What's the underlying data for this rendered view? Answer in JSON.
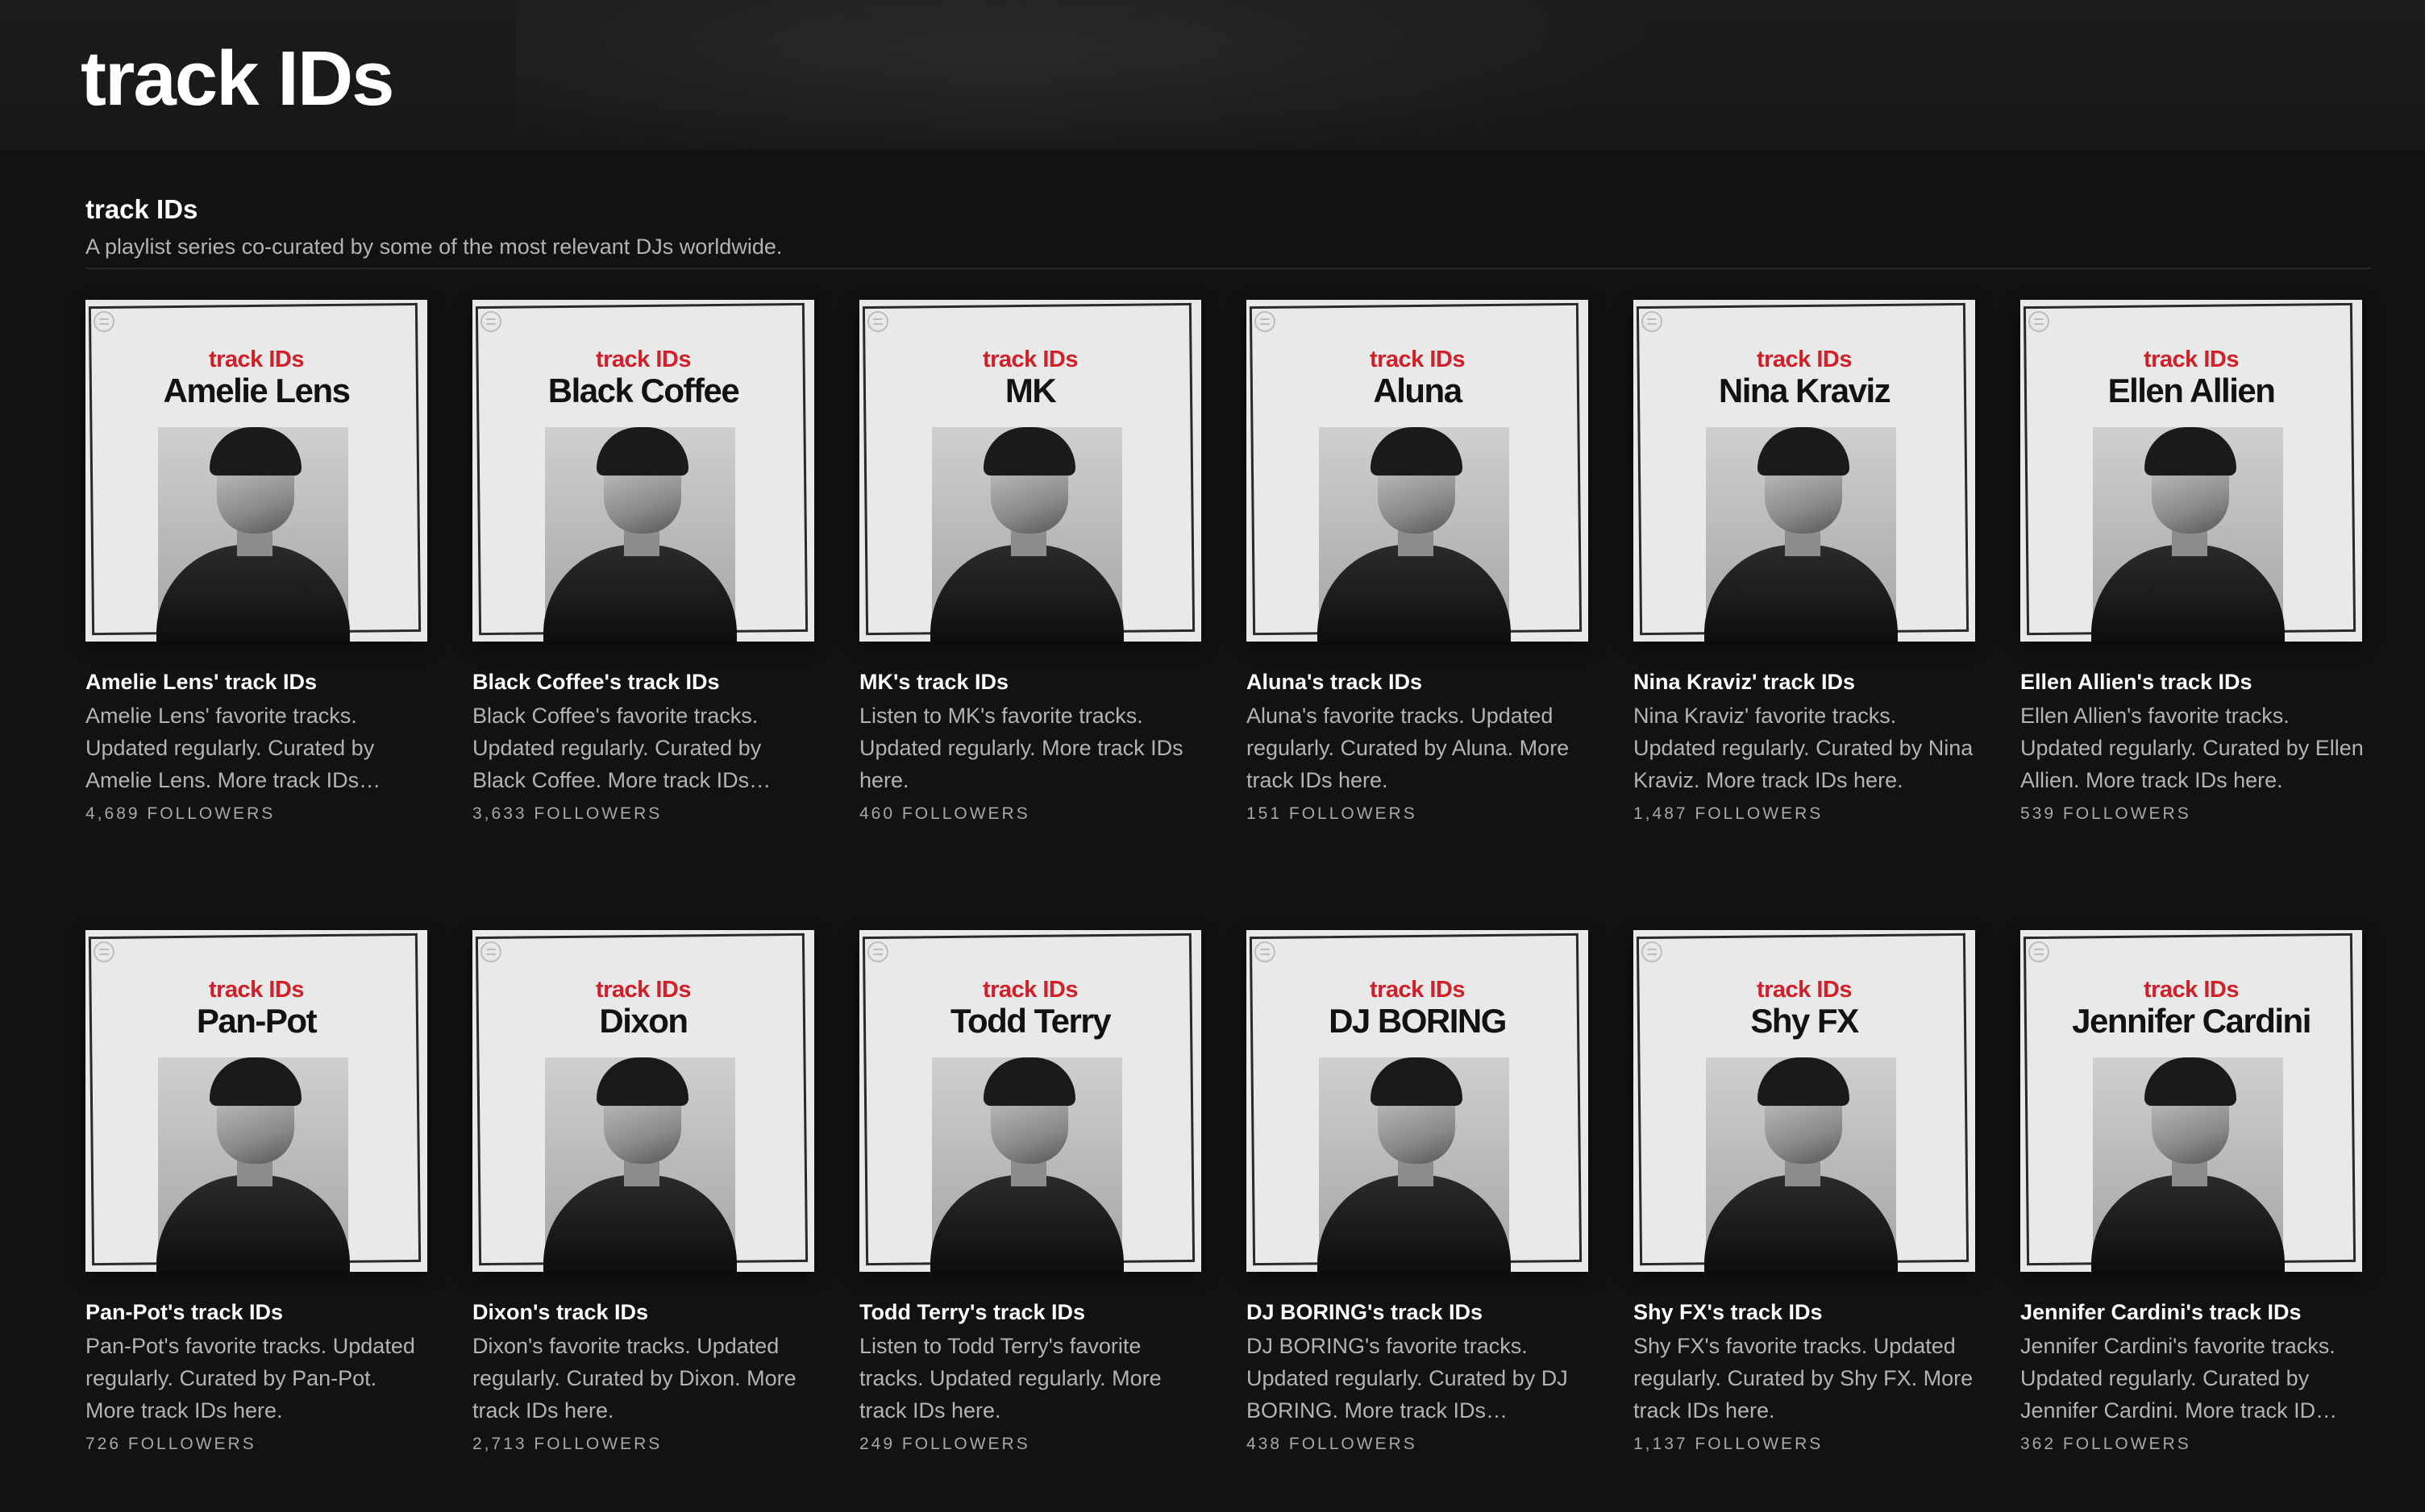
{
  "page": {
    "title": "track IDs"
  },
  "section": {
    "title": "track IDs",
    "description": "A playlist series co-curated by some of the most relevant DJs worldwide."
  },
  "cover_brand": "track IDs",
  "playlists": [
    {
      "artist": "Amelie Lens",
      "title": "Amelie Lens' track IDs",
      "description": "Amelie Lens' favorite tracks. Updated regularly. Curated by Amelie Lens. More track IDs…",
      "followers": "4,689 FOLLOWERS"
    },
    {
      "artist": "Black Coffee",
      "title": "Black Coffee's track IDs",
      "description": "Black Coffee's favorite tracks. Updated regularly. Curated by Black Coffee. More track IDs…",
      "followers": "3,633 FOLLOWERS"
    },
    {
      "artist": "MK",
      "title": "MK's track IDs",
      "description": "Listen to MK's favorite tracks. Updated regularly. More track IDs here.",
      "followers": "460 FOLLOWERS"
    },
    {
      "artist": "Aluna",
      "title": "Aluna's track IDs",
      "description": "Aluna's favorite tracks. Updated regularly. Curated by Aluna. More track IDs here.",
      "followers": "151 FOLLOWERS"
    },
    {
      "artist": "Nina Kraviz",
      "title": "Nina Kraviz' track IDs",
      "description": "Nina Kraviz' favorite tracks. Updated regularly. Curated by Nina Kraviz. More track IDs here.",
      "followers": "1,487 FOLLOWERS"
    },
    {
      "artist": "Ellen Allien",
      "title": "Ellen Allien's track IDs",
      "description": "Ellen Allien's favorite tracks. Updated regularly. Curated by Ellen Allien. More track IDs here.",
      "followers": "539 FOLLOWERS"
    },
    {
      "artist": "Pan-Pot",
      "title": "Pan-Pot's track IDs",
      "description": "Pan-Pot's favorite tracks. Updated regularly. Curated by Pan-Pot. More track IDs here.",
      "followers": "726 FOLLOWERS"
    },
    {
      "artist": "Dixon",
      "title": "Dixon's track IDs",
      "description": "Dixon's favorite tracks. Updated regularly. Curated by Dixon. More track IDs here.",
      "followers": "2,713 FOLLOWERS"
    },
    {
      "artist": "Todd Terry",
      "title": "Todd Terry's track IDs",
      "description": "Listen to Todd Terry's favorite tracks. Updated regularly. More track IDs here.",
      "followers": "249 FOLLOWERS"
    },
    {
      "artist": "DJ BORING",
      "title": "DJ BORING's track IDs",
      "description": "DJ BORING's favorite tracks. Updated regularly. Curated by DJ BORING. More track IDs…",
      "followers": "438 FOLLOWERS"
    },
    {
      "artist": "Shy FX",
      "title": "Shy FX's track IDs",
      "description": "Shy FX's favorite tracks. Updated regularly. Curated by Shy FX. More track IDs here.",
      "followers": "1,137 FOLLOWERS"
    },
    {
      "artist": "Jennifer Cardini",
      "title": "Jennifer Cardini's track IDs",
      "description": "Jennifer Cardini's favorite tracks. Updated regularly. Curated by Jennifer Cardini. More track ID…",
      "followers": "362 FOLLOWERS"
    }
  ],
  "colors": {
    "background": "#121212",
    "brand_red": "#d0202a",
    "text_primary": "#ffffff",
    "text_secondary": "#b3b3b3"
  },
  "icons": {
    "cover_logo": "spotify-logo-icon"
  }
}
